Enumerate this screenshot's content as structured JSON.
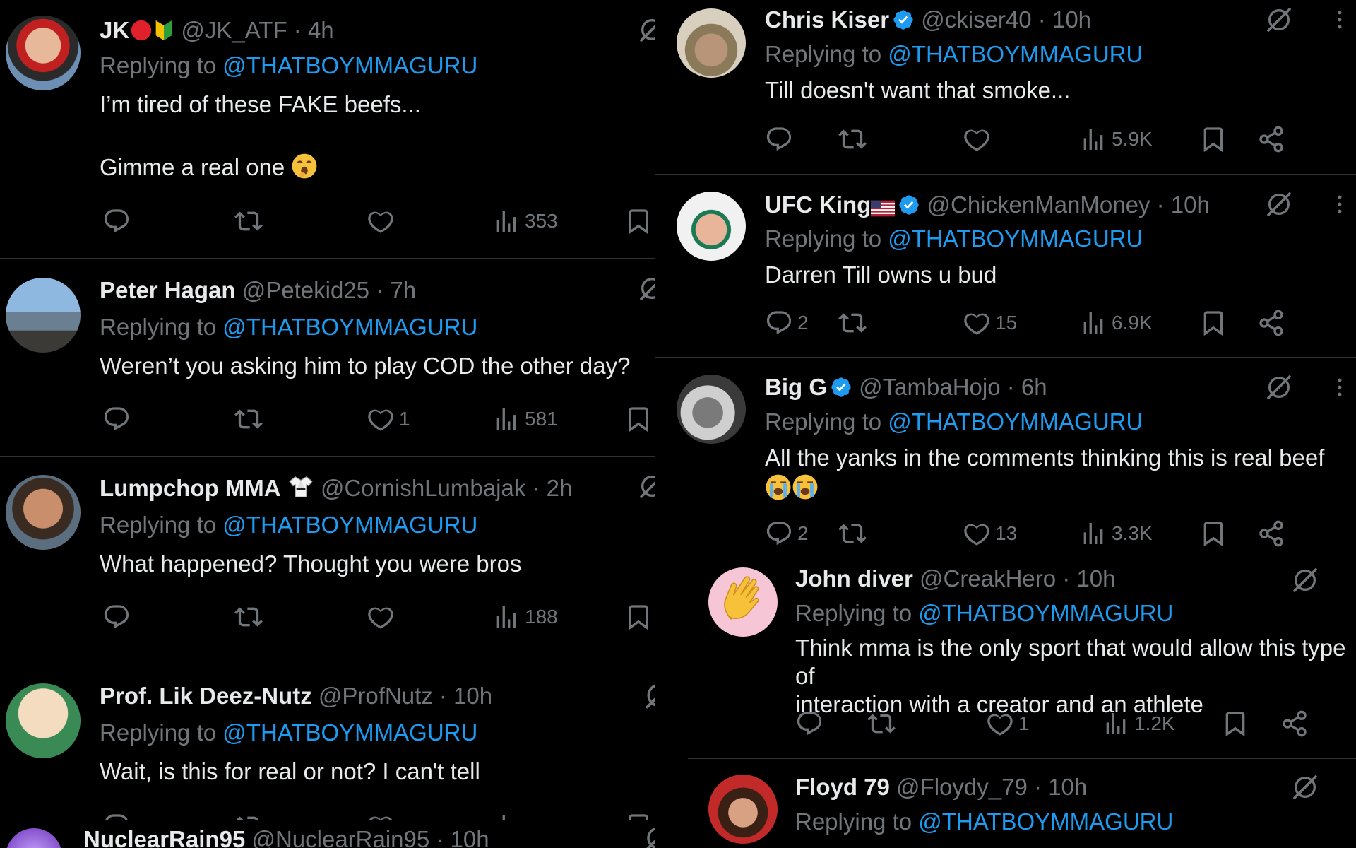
{
  "common": {
    "replying_label": "Replying to",
    "mention": "@THATBOYMMAGURU"
  },
  "left_column": [
    {
      "name": "JK",
      "handle": "@JK_ATF",
      "time": "4h",
      "lines": [
        "I’m tired of these FAKE beefs...",
        "",
        "Gimme a real one"
      ],
      "replies": "",
      "retweets": "",
      "likes": "",
      "views": "353"
    },
    {
      "name": "Peter Hagan",
      "handle": "@Petekid25",
      "time": "7h",
      "lines": [
        "Weren’t you asking him to play COD the other day?"
      ],
      "replies": "",
      "retweets": "",
      "likes": "1",
      "views": "581"
    },
    {
      "name": "Lumpchop MMA",
      "handle": "@CornishLumbajak",
      "time": "2h",
      "lines": [
        "What happened? Thought you were bros"
      ],
      "replies": "",
      "retweets": "",
      "likes": "",
      "views": "188"
    },
    {
      "name": "Prof. Lik Deez-Nutz",
      "handle": "@ProfNutz",
      "time": "10h",
      "lines": [
        "Wait, is this for real or not? I can't tell"
      ],
      "replies": "",
      "retweets": "",
      "likes": "",
      "views": ""
    },
    {
      "name": "NuclearRain95",
      "handle": "@NuclearRain95",
      "time": "10h"
    }
  ],
  "right_column": [
    {
      "name": "Chris Kiser",
      "handle": "@ckiser40",
      "time": "10h",
      "lines": [
        "Till doesn't want that smoke..."
      ],
      "replies": "",
      "retweets": "",
      "likes": "",
      "views": "5.9K"
    },
    {
      "name": "UFC King",
      "handle": "@ChickenManMoney",
      "time": "10h",
      "lines": [
        "Darren Till owns u bud"
      ],
      "replies": "2",
      "retweets": "",
      "likes": "15",
      "views": "6.9K"
    },
    {
      "name": "Big G",
      "handle": "@TambaHojo",
      "time": "6h",
      "lines": [
        "All the yanks in the comments thinking this is real beef"
      ],
      "replies": "2",
      "retweets": "",
      "likes": "13",
      "views": "3.3K"
    },
    {
      "name": "John diver",
      "handle": "@CreakHero",
      "time": "10h",
      "lines": [
        "Think mma is the only sport that would allow this type of",
        "interaction with a creator and an athlete"
      ],
      "replies": "",
      "retweets": "",
      "likes": "1",
      "views": "1.2K"
    },
    {
      "name": "Floyd 79",
      "handle": "@Floydy_79",
      "time": "10h"
    }
  ],
  "colors": {
    "background": "#000000",
    "text": "#e7e9ea",
    "muted": "#71767b",
    "link": "#1d9bf0",
    "verified": "#1d9bf0",
    "separator": "#2f3336"
  },
  "icons": [
    "reply-icon",
    "retweet-icon",
    "like-icon",
    "views-icon",
    "bookmark-icon",
    "share-icon",
    "grok-icon",
    "more-icon",
    "verified-badge-icon"
  ]
}
